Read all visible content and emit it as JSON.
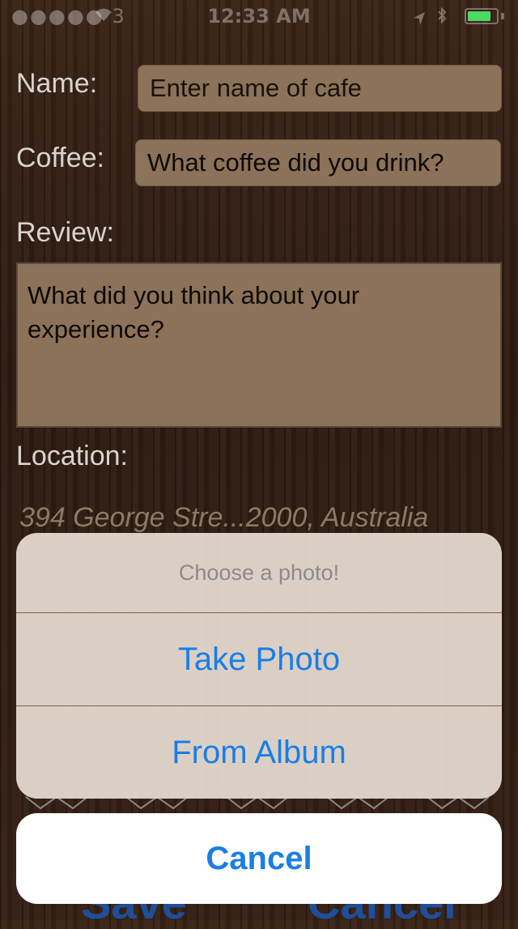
{
  "status_bar": {
    "carrier": "●●●●● 3",
    "time": "12:33 AM"
  },
  "form": {
    "name_label": "Name:",
    "name_placeholder": "Enter name of cafe",
    "coffee_label": "Coffee:",
    "coffee_placeholder": "What coffee did you drink?",
    "review_label": "Review:",
    "review_placeholder": "What did you think about your experience?",
    "location_label": "Location:",
    "location_value": "394 George Stre...2000, Australia"
  },
  "bottom": {
    "save_label": "Save",
    "cancel_label": "Cancel"
  },
  "action_sheet": {
    "title": "Choose a photo!",
    "options": [
      {
        "label": "Take Photo"
      },
      {
        "label": "From Album"
      }
    ],
    "cancel_label": "Cancel"
  },
  "colors": {
    "background": "#2c1a10",
    "field": "#8b7258",
    "label": "#d8d4cf",
    "action_blue": "#1a7ee6",
    "battery": "#4cd964"
  },
  "icons": [
    "wifi-icon",
    "location-arrow-icon",
    "bluetooth-icon",
    "battery-icon",
    "star-outline-icon"
  ]
}
